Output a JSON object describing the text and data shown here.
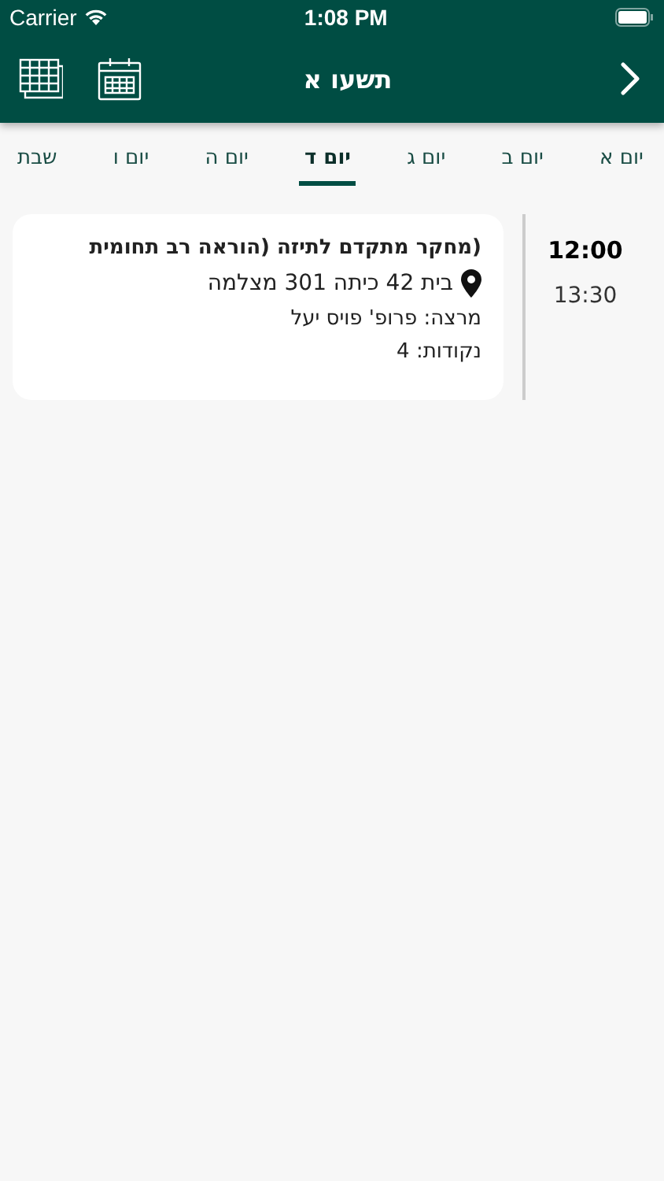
{
  "status_bar": {
    "carrier": "Carrier",
    "time": "1:08 PM"
  },
  "header": {
    "title": "תשעו א"
  },
  "tabs": [
    {
      "label": "יום א",
      "selected": false
    },
    {
      "label": "יום ב",
      "selected": false
    },
    {
      "label": "יום ג",
      "selected": false
    },
    {
      "label": "יום ד",
      "selected": true
    },
    {
      "label": "יום ה",
      "selected": false
    },
    {
      "label": "יום ו",
      "selected": false
    },
    {
      "label": "שבת",
      "selected": false
    }
  ],
  "events": [
    {
      "start": "12:00",
      "end": "13:30",
      "title": "(מחקר מתקדם לתיזה (הוראה רב תחומית",
      "location": "בית 42 כיתה 301 מצלמה",
      "lecturer": "מרצה: פרופ' פויס יעל",
      "credits": "נקודות: 4"
    }
  ]
}
